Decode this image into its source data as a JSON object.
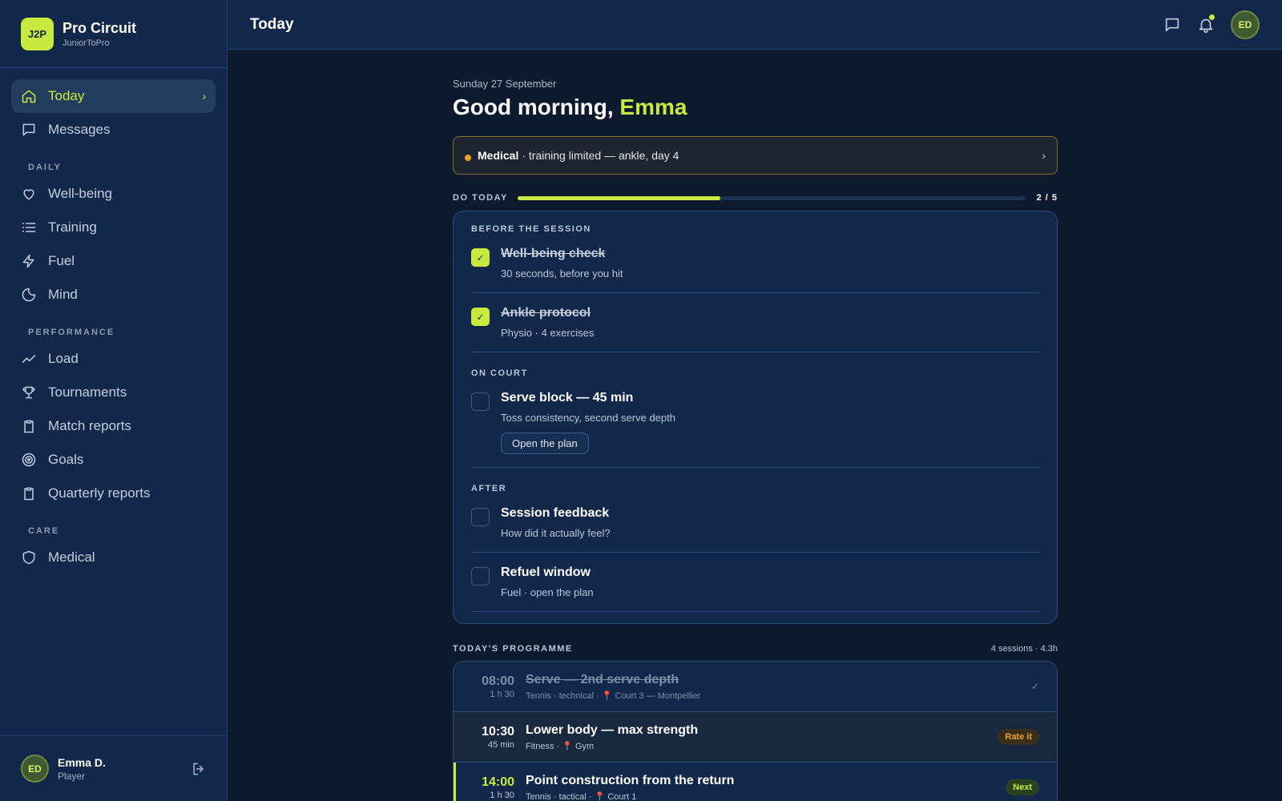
{
  "brand": {
    "logo": "J2P",
    "title": "Pro Circuit",
    "subtitle": "JuniorToPro"
  },
  "nav": {
    "today": "Today",
    "messages": "Messages",
    "section_daily": "DAILY",
    "wellbeing": "Well-being",
    "training": "Training",
    "fuel": "Fuel",
    "mind": "Mind",
    "section_performance": "PERFORMANCE",
    "load": "Load",
    "tournaments": "Tournaments",
    "match_reports": "Match reports",
    "goals": "Goals",
    "quarterly_reports": "Quarterly reports",
    "section_care": "CARE",
    "medical": "Medical"
  },
  "user": {
    "initials": "ED",
    "name": "Emma D.",
    "role": "Player"
  },
  "topbar": {
    "title": "Today",
    "avatar": "ED"
  },
  "header": {
    "date": "Sunday 27 September",
    "greeting": "Good morning,",
    "name": "Emma"
  },
  "alert": {
    "label": "Medical",
    "text": "· training limited — ankle, day 4"
  },
  "progress": {
    "label": "DO TODAY",
    "done": 2,
    "total": 5,
    "count": "2 / 5"
  },
  "tasks": {
    "group_before": "BEFORE THE SESSION",
    "wellbeing": {
      "title": "Well-being check",
      "sub": "30 seconds, before you hit",
      "done": true
    },
    "ankle": {
      "title": "Ankle protocol",
      "sub": "Physio · 4 exercises",
      "done": true
    },
    "group_court": "ON COURT",
    "serve": {
      "title": "Serve block — 45 min",
      "sub": "Toss consistency, second serve depth",
      "button": "Open the plan",
      "done": false
    },
    "group_after": "AFTER",
    "feedback": {
      "title": "Session feedback",
      "sub": "How did it actually feel?",
      "done": false
    },
    "refuel": {
      "title": "Refuel window",
      "sub": "Fuel · open the plan",
      "done": false
    },
    "check_glyph": "✓"
  },
  "programme": {
    "title": "TODAY'S PROGRAMME",
    "meta": "4 sessions · 4.3h",
    "sessions": [
      {
        "time": "08:00",
        "duration": "1 h 30",
        "title": "Serve — 2nd serve depth",
        "sub": "Tennis · technical · 📍 Court 3 — Montpellier",
        "status": "✓"
      },
      {
        "time": "10:30",
        "duration": "45 min",
        "title": "Lower body — max strength",
        "sub": "Fitness · 📍 Gym",
        "status": "Rate it"
      },
      {
        "time": "14:00",
        "duration": "1 h 30",
        "title": "Point construction from the return",
        "sub": "Tennis · tactical · 📍 Court 1",
        "status": "Next"
      }
    ]
  },
  "colors": {
    "accent": "#c8ea40",
    "warning": "#f0a020",
    "background": "#0d1a2e",
    "panel": "#12284a"
  }
}
